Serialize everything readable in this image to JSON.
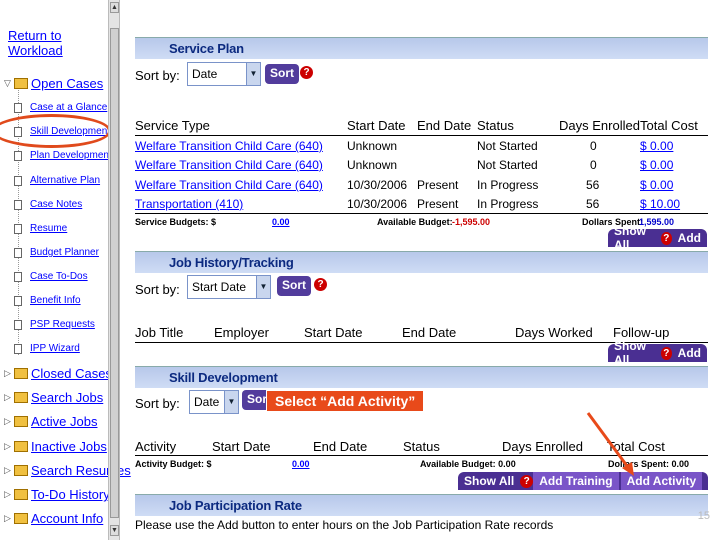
{
  "sidebar": {
    "return_link": "Return to Workload",
    "open_cases": "Open Cases",
    "sub_items": [
      "Case at a Glance",
      "Skill Development",
      "Plan Development",
      "Alternative Plan",
      "Case Notes",
      "Resume",
      "Budget Planner",
      "Case To-Dos",
      "Benefit Info",
      "PSP Requests",
      "IPP Wizard"
    ],
    "folders": [
      "Closed Cases",
      "Search Jobs",
      "Active Jobs",
      "Inactive Jobs",
      "Search Resumes",
      "To-Do History",
      "Account Info"
    ]
  },
  "service_plan": {
    "title": "Service Plan",
    "sort_label": "Sort by:",
    "sort_value": "Date",
    "sort_button": "Sort",
    "columns": [
      "Service Type",
      "Start Date",
      "End Date",
      "Status",
      "Days Enrolled",
      "Total Cost"
    ],
    "rows": [
      {
        "type": "Welfare Transition Child Care (640)",
        "start": "Unknown",
        "end": "",
        "status": "Not Started",
        "days": "0",
        "cost": "$ 0.00"
      },
      {
        "type": "Welfare Transition Child Care (640)",
        "start": "Unknown",
        "end": "",
        "status": "Not Started",
        "days": "0",
        "cost": "$ 0.00"
      },
      {
        "type": "Welfare Transition Child Care (640)",
        "start": "10/30/2006",
        "end": "Present",
        "status": "In Progress",
        "days": "56",
        "cost": "$ 0.00"
      },
      {
        "type": "Transportation (410)",
        "start": "10/30/2006",
        "end": "Present",
        "status": "In Progress",
        "days": "56",
        "cost": "$ 10.00"
      }
    ],
    "budget_label": "Service Budgets: $",
    "budget_value": "0.00",
    "available_label": "Available Budget:",
    "available_value": "-1,595.00",
    "spent_label": "Dollars Spent:",
    "spent_value": "1,595.00",
    "show_all": "Show All",
    "add": "Add"
  },
  "job_history": {
    "title": "Job History/Tracking",
    "sort_label": "Sort by:",
    "sort_value": "Start Date",
    "sort_button": "Sort",
    "columns": [
      "Job Title",
      "Employer",
      "Start Date",
      "End Date",
      "Days Worked",
      "Follow-up"
    ],
    "show_all": "Show All",
    "add": "Add"
  },
  "skill_dev": {
    "title": "Skill Development",
    "sort_label": "Sort by:",
    "sort_value": "Date",
    "sort_button": "Sort",
    "columns": [
      "Activity",
      "Start Date",
      "End Date",
      "Status",
      "Days Enrolled",
      "Total Cost"
    ],
    "budget_label": "Activity Budget: $",
    "budget_value": "0.00",
    "available_label": "Available Budget: 0.00",
    "spent_label": "Dollars Spent: 0.00",
    "show_all": "Show All",
    "add_training": "Add Training",
    "add_activity": "Add Activity"
  },
  "job_participation": {
    "title": "Job Participation Rate",
    "note": "Please use the Add button to enter hours on the Job Participation Rate records"
  },
  "callout": "Select “Add Activity”",
  "page_number": "15",
  "colors": {
    "callout": "#e84a1a",
    "header": "#0c2a80",
    "button": "#4a2f92",
    "link": "#0000ff"
  }
}
